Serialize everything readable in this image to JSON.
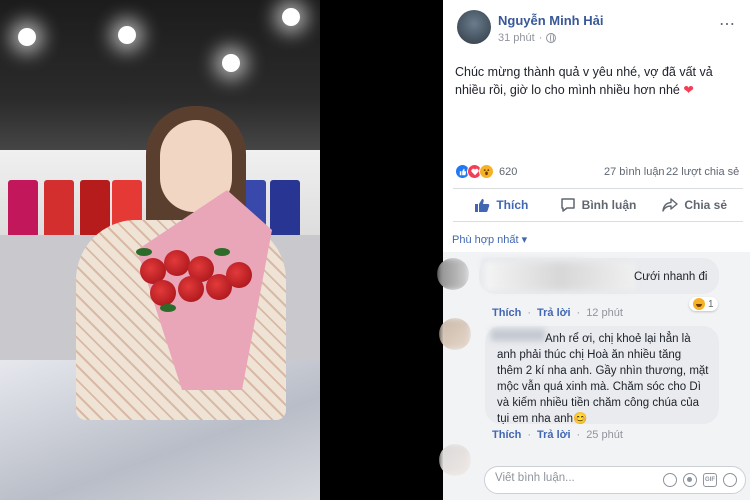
{
  "post": {
    "author_name": "Nguyễn Minh Hải",
    "time": "31 phút",
    "privacy_icon": "globe-icon",
    "more_icon": "⋯",
    "text": "Chúc mừng thành quả v yêu nhé, vợ đã vất vả nhiều rồi, giờ lo cho mình nhiều hơn nhé",
    "text_emoji": "❤"
  },
  "reactions": {
    "icons": [
      "like-icon",
      "love-icon",
      "wow-icon"
    ],
    "count": "620",
    "comments": "27 bình luận",
    "shares": "22 lượt chia sẻ"
  },
  "actions": {
    "like": "Thích",
    "comment": "Bình luận",
    "share": "Chia sẻ"
  },
  "comments": {
    "sort_label": "Phù hợp nhất ▾",
    "items": [
      {
        "text": "Cưới nhanh đi",
        "like": "Thích",
        "reply": "Trả lời",
        "time": "12 phút",
        "reaction_count": "1"
      },
      {
        "text": "Anh rể ơi, chị khoẻ lại hẳn là anh phải thúc chị Hoà ăn nhiều tăng thêm 2 kí nha anh. Gầy nhìn thương, mặt mộc vẫn quá xinh mà. Chăm sóc cho Dì và kiếm nhiều tiền chăm công chúa của tụi em nha anh😊",
        "like": "Thích",
        "reply": "Trả lời",
        "time": "25 phút"
      }
    ],
    "input_placeholder": "Viết bình luận...",
    "input_icons": [
      "emoji-icon",
      "camera-icon",
      "gif-icon",
      "sticker-icon"
    ],
    "gif_label": "GIF"
  },
  "colors": {
    "link": "#385898",
    "action_blue": "#4267b2",
    "meta_gray": "#90949c",
    "heart": "#f33e58"
  }
}
